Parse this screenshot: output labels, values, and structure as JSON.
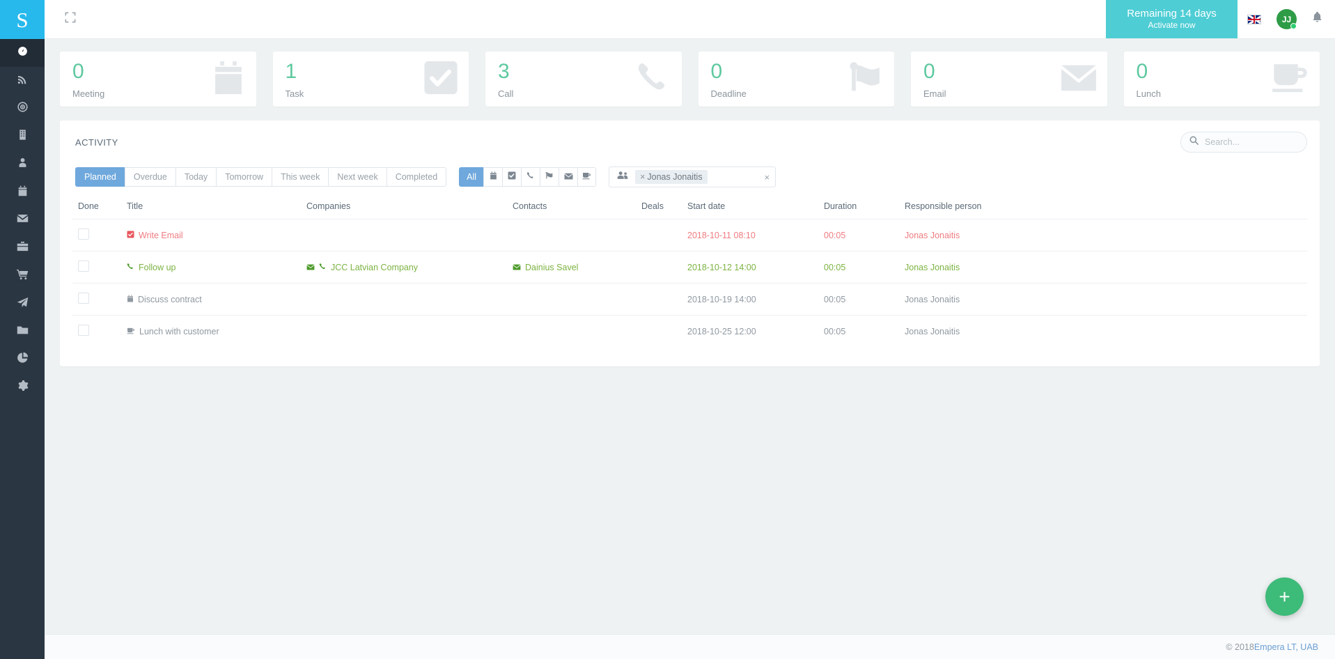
{
  "brand": {
    "logo_letter": "S",
    "logo_color": "#27b9ec"
  },
  "sidebar": {
    "items": [
      {
        "name": "dashboard",
        "icon": "speedometer-icon",
        "active": true
      },
      {
        "name": "feed",
        "icon": "rss-icon",
        "active": false
      },
      {
        "name": "targets",
        "icon": "target-icon",
        "active": false
      },
      {
        "name": "companies",
        "icon": "building-icon",
        "active": false
      },
      {
        "name": "contacts",
        "icon": "user-icon",
        "active": false
      },
      {
        "name": "calendar",
        "icon": "calendar-icon",
        "active": false
      },
      {
        "name": "mail",
        "icon": "envelope-icon",
        "active": false
      },
      {
        "name": "deals",
        "icon": "briefcase-icon",
        "active": false
      },
      {
        "name": "orders",
        "icon": "cart-icon",
        "active": false
      },
      {
        "name": "campaigns",
        "icon": "paper-plane-icon",
        "active": false
      },
      {
        "name": "files",
        "icon": "folder-icon",
        "active": false
      },
      {
        "name": "reports",
        "icon": "pie-chart-icon",
        "active": false
      },
      {
        "name": "settings",
        "icon": "gear-icon",
        "active": false
      }
    ]
  },
  "topbar": {
    "expand_icon": "expand-icon",
    "trial": {
      "title": "Remaining 14 days",
      "subtitle": "Activate now",
      "color": "#4ecdd4"
    },
    "language": "en-gb-flag-icon",
    "avatar": {
      "initials": "JJ",
      "color": "#2e9c46",
      "status": "online"
    },
    "notifications_icon": "bell-icon"
  },
  "cards": [
    {
      "value": "0",
      "label": "Meeting",
      "icon": "calendar-icon"
    },
    {
      "value": "1",
      "label": "Task",
      "icon": "check-square-icon"
    },
    {
      "value": "3",
      "label": "Call",
      "icon": "phone-icon"
    },
    {
      "value": "0",
      "label": "Deadline",
      "icon": "flag-icon"
    },
    {
      "value": "0",
      "label": "Email",
      "icon": "envelope-icon"
    },
    {
      "value": "0",
      "label": "Lunch",
      "icon": "coffee-icon"
    }
  ],
  "panel": {
    "title": "ACTIVITY",
    "search": {
      "placeholder": "Search...",
      "value": "",
      "icon": "search-icon"
    },
    "time_filters": [
      {
        "label": "Planned",
        "active": true
      },
      {
        "label": "Overdue",
        "active": false
      },
      {
        "label": "Today",
        "active": false
      },
      {
        "label": "Tomorrow",
        "active": false
      },
      {
        "label": "This week",
        "active": false
      },
      {
        "label": "Next week",
        "active": false
      },
      {
        "label": "Completed",
        "active": false
      }
    ],
    "type_filters": [
      {
        "label": "All",
        "icon": "",
        "active": true
      },
      {
        "label": "",
        "icon": "calendar-icon",
        "active": false
      },
      {
        "label": "",
        "icon": "check-square-icon",
        "active": false
      },
      {
        "label": "",
        "icon": "phone-icon",
        "active": false
      },
      {
        "label": "",
        "icon": "flag-icon",
        "active": false
      },
      {
        "label": "",
        "icon": "envelope-icon",
        "active": false
      },
      {
        "label": "",
        "icon": "coffee-icon",
        "active": false
      }
    ],
    "person_filter": {
      "icon": "users-icon",
      "tag_remove": "×",
      "tag": "Jonas Jonaitis",
      "clear": "×"
    }
  },
  "table": {
    "headers": [
      "Done",
      "Title",
      "Companies",
      "Contacts",
      "Deals",
      "Start date",
      "Duration",
      "Responsible person"
    ],
    "rows": [
      {
        "done": false,
        "title": "Write Email",
        "title_icon": "check-square-icon",
        "company": "",
        "company_icons": [],
        "contact": "",
        "contact_icon": "",
        "deal": "",
        "start_date": "2018-10-11 08:10",
        "duration": "00:05",
        "responsible": "Jonas Jonaitis",
        "state": "overdue"
      },
      {
        "done": false,
        "title": "Follow up",
        "title_icon": "phone-icon",
        "company": "JCC Latvian Company",
        "company_icons": [
          "envelope-icon",
          "phone-icon"
        ],
        "contact": "Dainius Savel",
        "contact_icon": "envelope-icon",
        "deal": "",
        "start_date": "2018-10-12 14:00",
        "duration": "00:05",
        "responsible": "Jonas Jonaitis",
        "state": "today"
      },
      {
        "done": false,
        "title": "Discuss contract",
        "title_icon": "calendar-icon",
        "company": "",
        "company_icons": [],
        "contact": "",
        "contact_icon": "",
        "deal": "",
        "start_date": "2018-10-19 14:00",
        "duration": "00:05",
        "responsible": "Jonas Jonaitis",
        "state": "planned"
      },
      {
        "done": false,
        "title": "Lunch with customer",
        "title_icon": "coffee-icon",
        "company": "",
        "company_icons": [],
        "contact": "",
        "contact_icon": "",
        "deal": "",
        "start_date": "2018-10-25 12:00",
        "duration": "00:05",
        "responsible": "Jonas Jonaitis",
        "state": "planned"
      }
    ]
  },
  "fab": {
    "label": "+",
    "color": "#3dbb78"
  },
  "footer": {
    "copyright": "© 2018 ",
    "company": "Empera LT, UAB"
  }
}
